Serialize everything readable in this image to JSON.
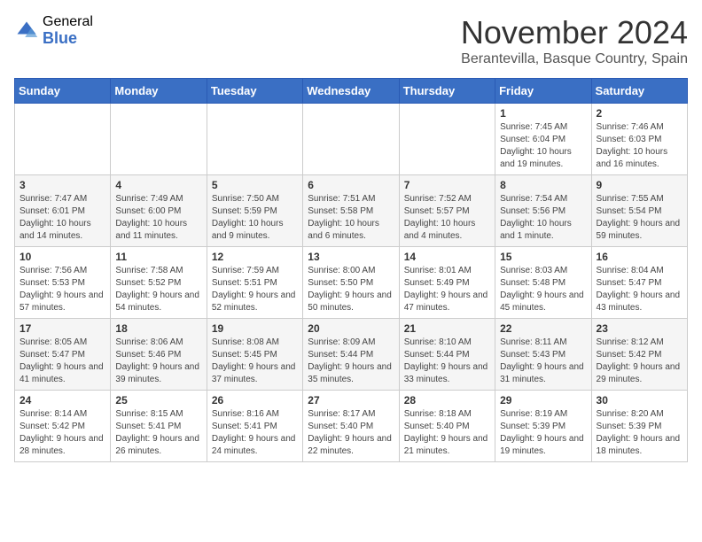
{
  "logo": {
    "general": "General",
    "blue": "Blue"
  },
  "header": {
    "month": "November 2024",
    "location": "Berantevilla, Basque Country, Spain"
  },
  "weekdays": [
    "Sunday",
    "Monday",
    "Tuesday",
    "Wednesday",
    "Thursday",
    "Friday",
    "Saturday"
  ],
  "weeks": [
    [
      {
        "day": "",
        "info": ""
      },
      {
        "day": "",
        "info": ""
      },
      {
        "day": "",
        "info": ""
      },
      {
        "day": "",
        "info": ""
      },
      {
        "day": "",
        "info": ""
      },
      {
        "day": "1",
        "info": "Sunrise: 7:45 AM\nSunset: 6:04 PM\nDaylight: 10 hours and 19 minutes."
      },
      {
        "day": "2",
        "info": "Sunrise: 7:46 AM\nSunset: 6:03 PM\nDaylight: 10 hours and 16 minutes."
      }
    ],
    [
      {
        "day": "3",
        "info": "Sunrise: 7:47 AM\nSunset: 6:01 PM\nDaylight: 10 hours and 14 minutes."
      },
      {
        "day": "4",
        "info": "Sunrise: 7:49 AM\nSunset: 6:00 PM\nDaylight: 10 hours and 11 minutes."
      },
      {
        "day": "5",
        "info": "Sunrise: 7:50 AM\nSunset: 5:59 PM\nDaylight: 10 hours and 9 minutes."
      },
      {
        "day": "6",
        "info": "Sunrise: 7:51 AM\nSunset: 5:58 PM\nDaylight: 10 hours and 6 minutes."
      },
      {
        "day": "7",
        "info": "Sunrise: 7:52 AM\nSunset: 5:57 PM\nDaylight: 10 hours and 4 minutes."
      },
      {
        "day": "8",
        "info": "Sunrise: 7:54 AM\nSunset: 5:56 PM\nDaylight: 10 hours and 1 minute."
      },
      {
        "day": "9",
        "info": "Sunrise: 7:55 AM\nSunset: 5:54 PM\nDaylight: 9 hours and 59 minutes."
      }
    ],
    [
      {
        "day": "10",
        "info": "Sunrise: 7:56 AM\nSunset: 5:53 PM\nDaylight: 9 hours and 57 minutes."
      },
      {
        "day": "11",
        "info": "Sunrise: 7:58 AM\nSunset: 5:52 PM\nDaylight: 9 hours and 54 minutes."
      },
      {
        "day": "12",
        "info": "Sunrise: 7:59 AM\nSunset: 5:51 PM\nDaylight: 9 hours and 52 minutes."
      },
      {
        "day": "13",
        "info": "Sunrise: 8:00 AM\nSunset: 5:50 PM\nDaylight: 9 hours and 50 minutes."
      },
      {
        "day": "14",
        "info": "Sunrise: 8:01 AM\nSunset: 5:49 PM\nDaylight: 9 hours and 47 minutes."
      },
      {
        "day": "15",
        "info": "Sunrise: 8:03 AM\nSunset: 5:48 PM\nDaylight: 9 hours and 45 minutes."
      },
      {
        "day": "16",
        "info": "Sunrise: 8:04 AM\nSunset: 5:47 PM\nDaylight: 9 hours and 43 minutes."
      }
    ],
    [
      {
        "day": "17",
        "info": "Sunrise: 8:05 AM\nSunset: 5:47 PM\nDaylight: 9 hours and 41 minutes."
      },
      {
        "day": "18",
        "info": "Sunrise: 8:06 AM\nSunset: 5:46 PM\nDaylight: 9 hours and 39 minutes."
      },
      {
        "day": "19",
        "info": "Sunrise: 8:08 AM\nSunset: 5:45 PM\nDaylight: 9 hours and 37 minutes."
      },
      {
        "day": "20",
        "info": "Sunrise: 8:09 AM\nSunset: 5:44 PM\nDaylight: 9 hours and 35 minutes."
      },
      {
        "day": "21",
        "info": "Sunrise: 8:10 AM\nSunset: 5:44 PM\nDaylight: 9 hours and 33 minutes."
      },
      {
        "day": "22",
        "info": "Sunrise: 8:11 AM\nSunset: 5:43 PM\nDaylight: 9 hours and 31 minutes."
      },
      {
        "day": "23",
        "info": "Sunrise: 8:12 AM\nSunset: 5:42 PM\nDaylight: 9 hours and 29 minutes."
      }
    ],
    [
      {
        "day": "24",
        "info": "Sunrise: 8:14 AM\nSunset: 5:42 PM\nDaylight: 9 hours and 28 minutes."
      },
      {
        "day": "25",
        "info": "Sunrise: 8:15 AM\nSunset: 5:41 PM\nDaylight: 9 hours and 26 minutes."
      },
      {
        "day": "26",
        "info": "Sunrise: 8:16 AM\nSunset: 5:41 PM\nDaylight: 9 hours and 24 minutes."
      },
      {
        "day": "27",
        "info": "Sunrise: 8:17 AM\nSunset: 5:40 PM\nDaylight: 9 hours and 22 minutes."
      },
      {
        "day": "28",
        "info": "Sunrise: 8:18 AM\nSunset: 5:40 PM\nDaylight: 9 hours and 21 minutes."
      },
      {
        "day": "29",
        "info": "Sunrise: 8:19 AM\nSunset: 5:39 PM\nDaylight: 9 hours and 19 minutes."
      },
      {
        "day": "30",
        "info": "Sunrise: 8:20 AM\nSunset: 5:39 PM\nDaylight: 9 hours and 18 minutes."
      }
    ]
  ]
}
